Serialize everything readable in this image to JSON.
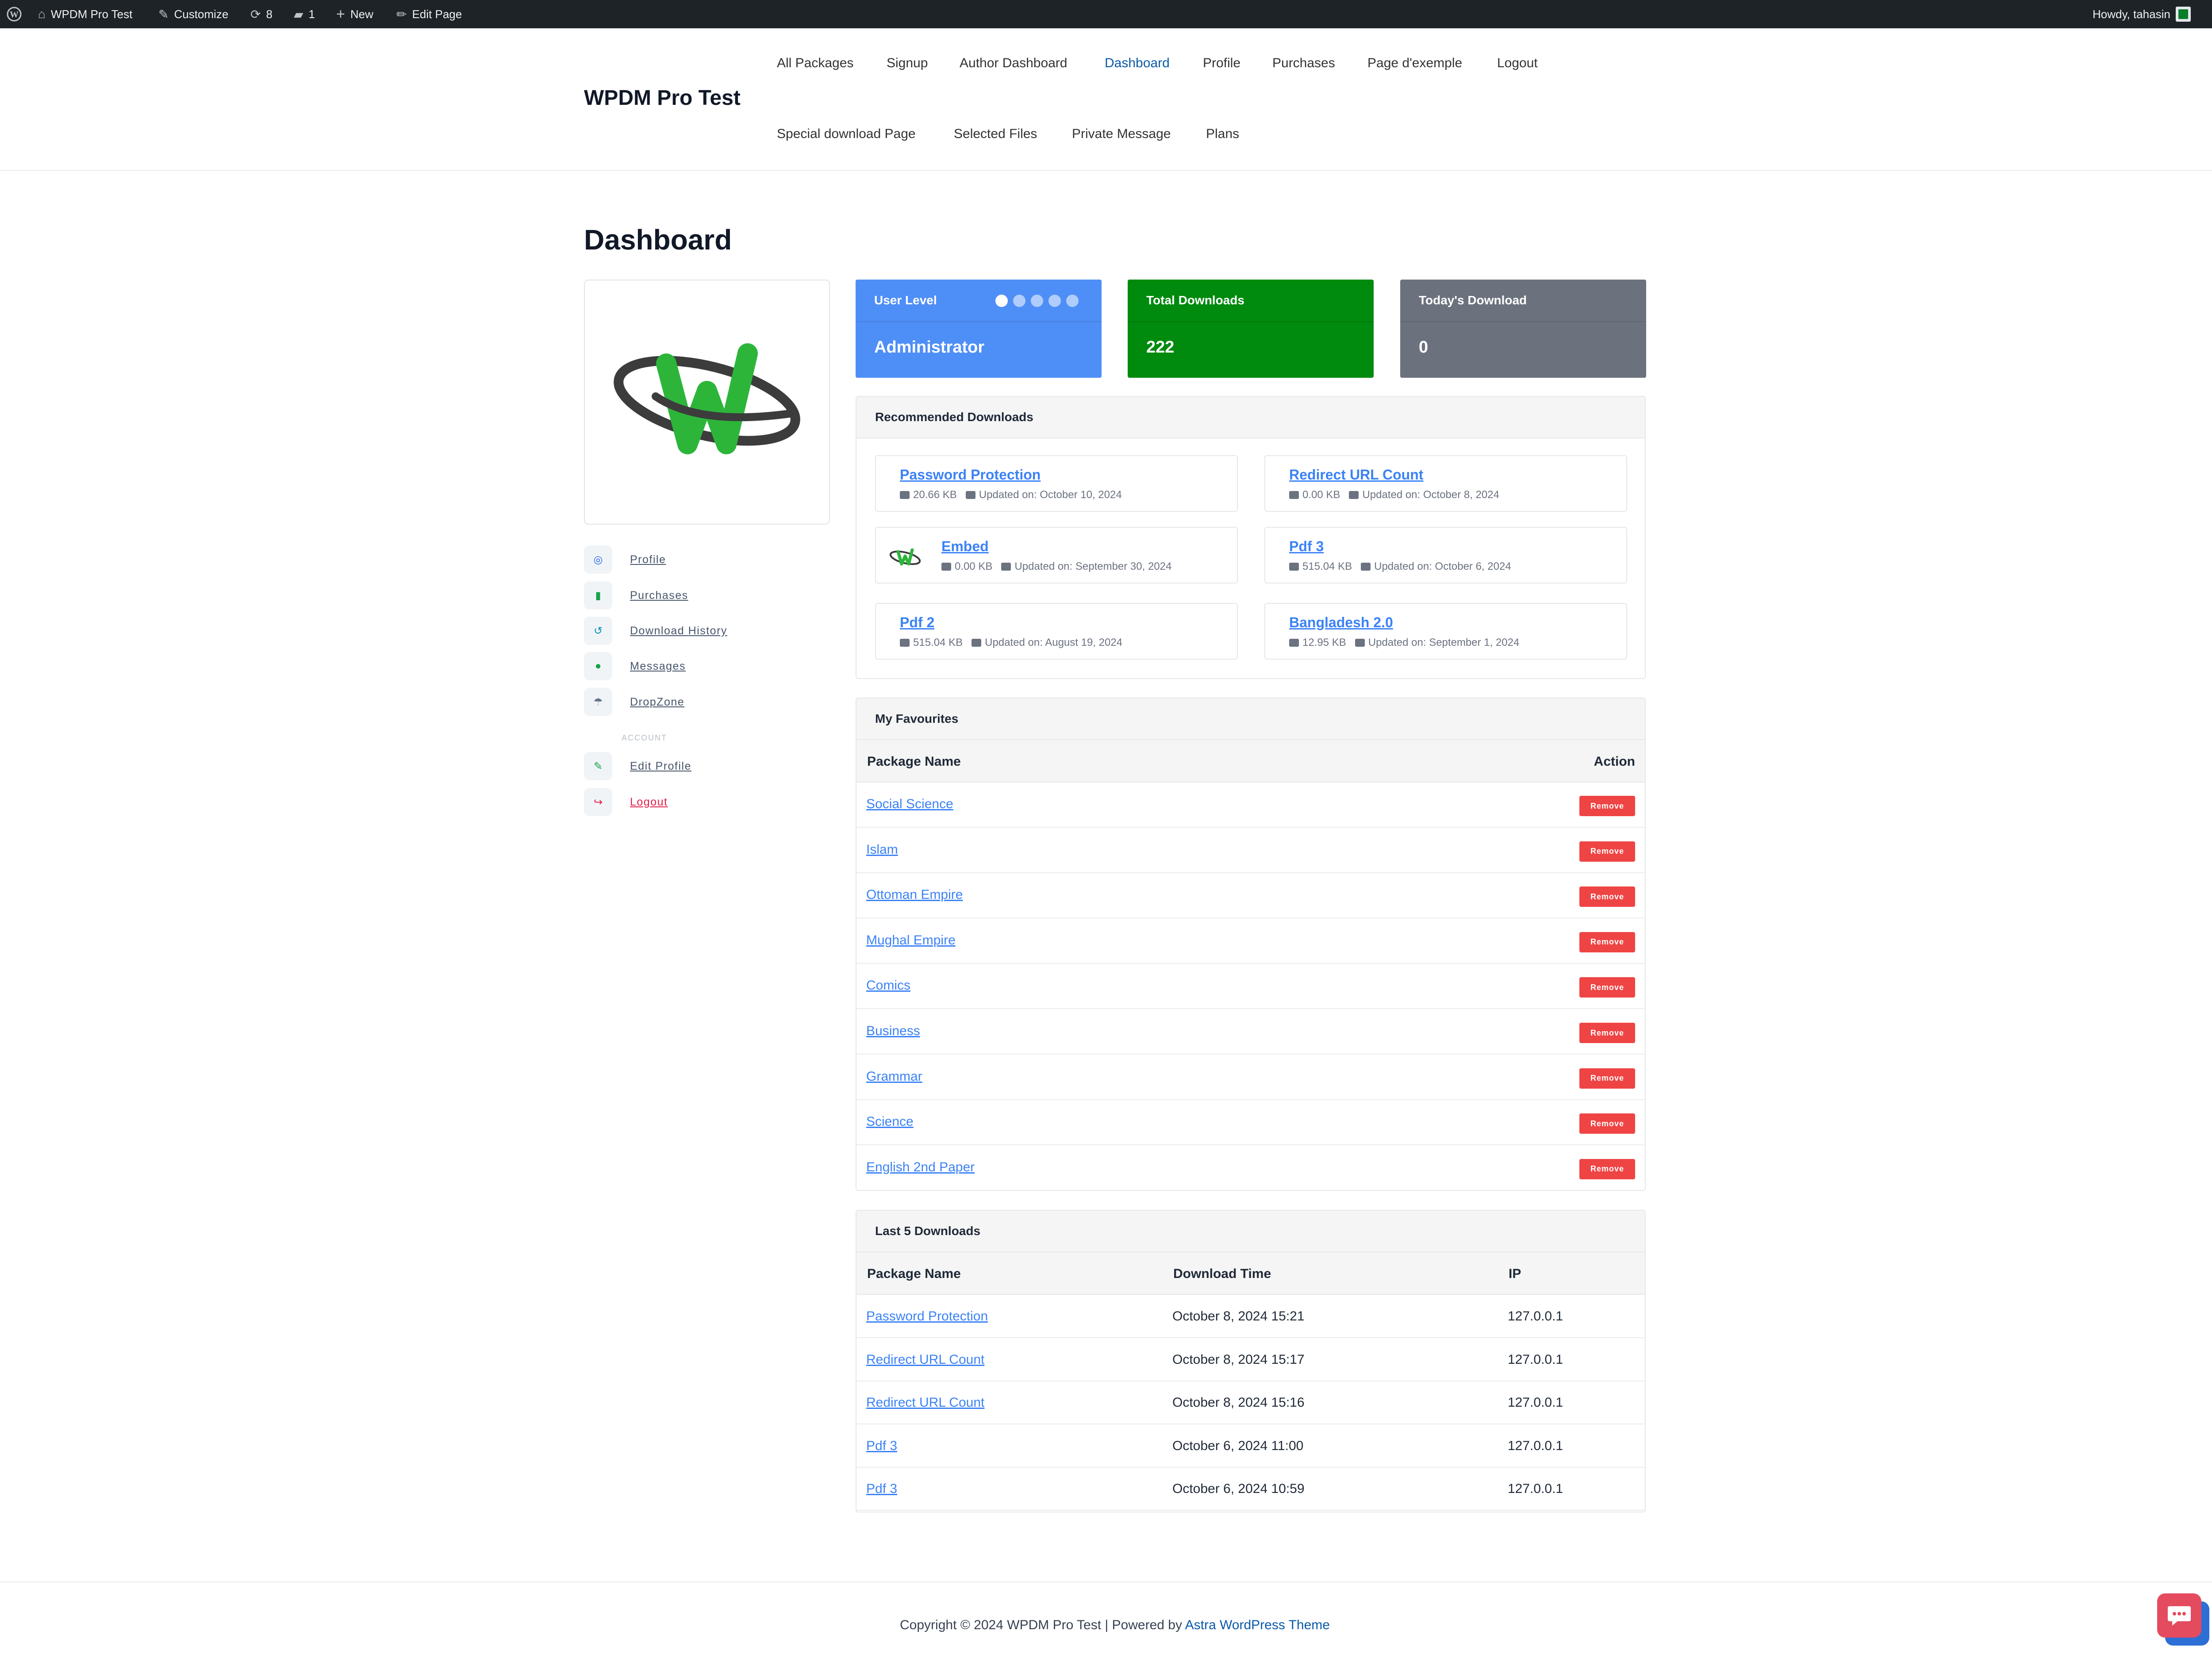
{
  "admin_bar": {
    "site_name": "WPDM Pro Test",
    "customize": "Customize",
    "updates_count": "8",
    "comments_count": "1",
    "new_label": "New",
    "edit_page": "Edit Page",
    "greeting": "Howdy, tahasin"
  },
  "site": {
    "title": "WPDM Pro Test"
  },
  "nav": {
    "row1": [
      "All Packages",
      "Signup",
      "Author Dashboard",
      "Dashboard",
      "Profile",
      "Purchases",
      "Page d'exemple",
      "Logout"
    ],
    "row2": [
      "Special download Page",
      "Selected Files",
      "Private Message",
      "Plans"
    ],
    "active": "Dashboard"
  },
  "page_title": "Dashboard",
  "side_menu": {
    "items": [
      "Profile",
      "Purchases",
      "Download History",
      "Messages",
      "DropZone"
    ],
    "account_heading": "ACCOUNT",
    "account_items": [
      "Edit Profile",
      "Logout"
    ]
  },
  "stats": {
    "user_level": {
      "label": "User Level",
      "value": "Administrator",
      "color": "#4e8ef7",
      "level": 1,
      "max_level": 5
    },
    "total_downloads": {
      "label": "Total Downloads",
      "value": "222",
      "color": "#008a0e"
    },
    "today_download": {
      "label": "Today's Download",
      "value": "0",
      "color": "#6c727d"
    }
  },
  "recommended": {
    "title": "Recommended Downloads",
    "items": [
      {
        "title": "Password Protection",
        "size": "20.66 KB",
        "updated": "Updated on: October 10, 2024"
      },
      {
        "title": "Redirect URL Count",
        "size": "0.00 KB",
        "updated": "Updated on: October 8, 2024"
      },
      {
        "title": "Embed",
        "size": "0.00 KB",
        "updated": "Updated on: September 30, 2024"
      },
      {
        "title": "Pdf 3",
        "size": "515.04 KB",
        "updated": "Updated on: October 6, 2024"
      },
      {
        "title": "Pdf 2",
        "size": "515.04 KB",
        "updated": "Updated on: August 19, 2024"
      },
      {
        "title": "Bangladesh 2.0",
        "size": "12.95 KB",
        "updated": "Updated on: September 1, 2024"
      }
    ]
  },
  "favourites": {
    "title": "My Favourites",
    "col_name": "Package Name",
    "col_action": "Action",
    "remove_label": "Remove",
    "rows": [
      "Social Science",
      "Islam",
      "Ottoman Empire",
      "Mughal Empire",
      "Comics",
      "Business",
      "Grammar",
      "Science",
      "English 2nd Paper"
    ]
  },
  "last_downloads": {
    "title": "Last 5 Downloads",
    "columns": [
      "Package Name",
      "Download Time",
      "IP"
    ],
    "rows": [
      {
        "name": "Password Protection",
        "time": "October 8, 2024 15:21",
        "ip": "127.0.0.1"
      },
      {
        "name": "Redirect URL Count",
        "time": "October 8, 2024 15:17",
        "ip": "127.0.0.1"
      },
      {
        "name": "Redirect URL Count",
        "time": "October 8, 2024 15:16",
        "ip": "127.0.0.1"
      },
      {
        "name": "Pdf 3",
        "time": "October 6, 2024 11:00",
        "ip": "127.0.0.1"
      },
      {
        "name": "Pdf 3",
        "time": "October 6, 2024 10:59",
        "ip": "127.0.0.1"
      }
    ]
  },
  "footer": {
    "text": "Copyright © 2024 WPDM Pro Test | Powered by ",
    "link": "Astra WordPress Theme"
  },
  "icons": {
    "admin_bar": [
      "wordpress-logo-icon",
      "dashboard-icon",
      "brush-icon",
      "updates-icon",
      "comment-icon",
      "plus-icon",
      "pencil-icon",
      "user-avatar-icon"
    ],
    "side_menu": [
      "user-circle-icon",
      "file-icon",
      "history-icon",
      "chat-icon",
      "parachute-icon",
      "user-edit-icon",
      "logout-icon"
    ],
    "chat_widget": "chat-bubble-icon"
  }
}
